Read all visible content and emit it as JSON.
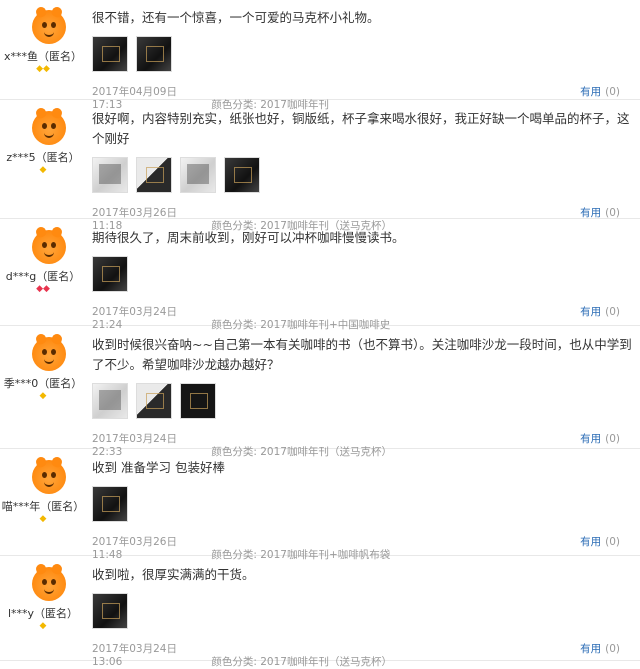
{
  "color_label": "颜色分类:",
  "helpful_label": "有用",
  "reviews": [
    {
      "user": "x***鱼（匿名）",
      "content": "很不错，还有一个惊喜，一个可爱的马克杯小礼物。",
      "date": "2017年04月09日 17:13",
      "color": "2017咖啡年刊",
      "helpful_count": "(0)",
      "gems": "◆◆",
      "thumbs": [
        "t-dark",
        "t-dark"
      ]
    },
    {
      "user": "z***5（匿名）",
      "content": "很好啊，内容特别充实，纸张也好，铜版纸，杯子拿来喝水很好，我正好缺一个喝单品的杯子，这个刚好",
      "date": "2017年03月26日 11:18",
      "color": "2017咖啡年刊（送马克杯）",
      "helpful_count": "(0)",
      "gems": "◆",
      "thumbs": [
        "t-light",
        "t-mixed",
        "t-light",
        "t-dark"
      ]
    },
    {
      "user": "d***g（匿名）",
      "content": "期待很久了，周末前收到，刚好可以冲杯咖啡慢慢读书。",
      "date": "2017年03月24日 21:24",
      "color": "2017咖啡年刊+中国咖啡史",
      "helpful_count": "(0)",
      "gems": "◆◆",
      "thumbs": [
        "t-dark"
      ]
    },
    {
      "user": "季***0（匿名）",
      "content": "收到时候很兴奋呐~~自己第一本有关咖啡的书（也不算书）。关注咖啡沙龙一段时间，也从中学到了不少。希望咖啡沙龙越办越好？",
      "date": "2017年03月24日 22:33",
      "color": "2017咖啡年刊（送马克杯）",
      "helpful_count": "(0)",
      "gems": "◆",
      "thumbs": [
        "t-light",
        "t-mixed",
        "t-black"
      ]
    },
    {
      "user": "喵***年（匿名）",
      "content": "收到 准备学习 包装好棒",
      "date": "2017年03月26日 11:48",
      "color": "2017咖啡年刊+咖啡帆布袋",
      "helpful_count": "(0)",
      "gems": "◆",
      "thumbs": [
        "t-dark"
      ]
    },
    {
      "user": "l***y（匿名）",
      "content": "收到啦，很厚实满满的干货。",
      "date": "2017年03月24日 13:06",
      "color": "2017咖啡年刊（送马克杯）",
      "helpful_count": "(0)",
      "gems": "◆",
      "thumbs": [
        "t-dark"
      ]
    }
  ]
}
